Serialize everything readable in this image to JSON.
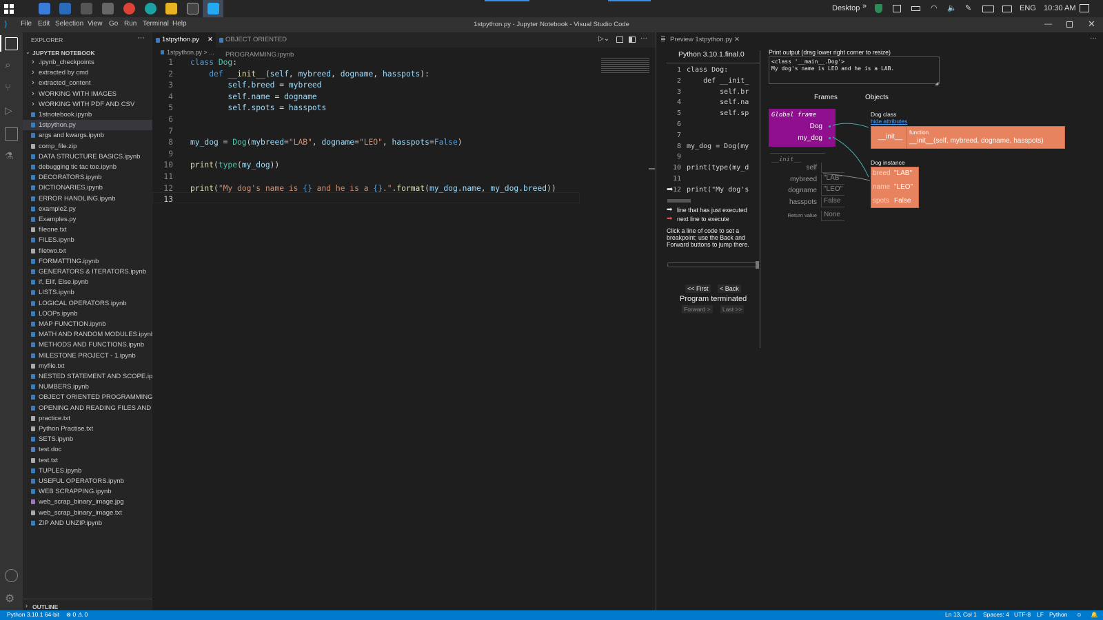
{
  "taskbar": {
    "desktop_label": "Desktop",
    "lang": "ENG",
    "time": "10:30 AM"
  },
  "window": {
    "title": "1stpython.py - Jupyter Notebook - Visual Studio Code",
    "menu": [
      "File",
      "Edit",
      "Selection",
      "View",
      "Go",
      "Run",
      "Terminal",
      "Help"
    ]
  },
  "explorer": {
    "header": "EXPLORER",
    "section": "JUPYTER NOTEBOOK",
    "outline": "OUTLINE",
    "items": [
      {
        "label": ".ipynb_checkpoints",
        "type": "folder"
      },
      {
        "label": "extracted by cmd",
        "type": "folder"
      },
      {
        "label": "extracted_content",
        "type": "folder"
      },
      {
        "label": "WORKING WITH IMAGES",
        "type": "folder"
      },
      {
        "label": "WORKING WITH PDF AND CSV",
        "type": "folder"
      },
      {
        "label": "1stnotebook.ipynb",
        "type": "notebook"
      },
      {
        "label": "1stpython.py",
        "type": "python"
      },
      {
        "label": "args and kwargs.ipynb",
        "type": "notebook"
      },
      {
        "label": "comp_file.zip",
        "type": "zip"
      },
      {
        "label": "DATA STRUCTURE BASICS.ipynb",
        "type": "notebook"
      },
      {
        "label": "debugging tic tac toe.ipynb",
        "type": "notebook"
      },
      {
        "label": "DECORATORS.ipynb",
        "type": "notebook"
      },
      {
        "label": "DICTIONARIES.ipynb",
        "type": "notebook"
      },
      {
        "label": "ERROR HANDLING.ipynb",
        "type": "notebook"
      },
      {
        "label": "example2.py",
        "type": "python"
      },
      {
        "label": "Examples.py",
        "type": "python"
      },
      {
        "label": "fileone.txt",
        "type": "text"
      },
      {
        "label": "FILES.ipynb",
        "type": "notebook"
      },
      {
        "label": "filetwo.txt",
        "type": "text"
      },
      {
        "label": "FORMATTING.ipynb",
        "type": "notebook"
      },
      {
        "label": "GENERATORS & ITERATORS.ipynb",
        "type": "notebook"
      },
      {
        "label": "if, Elif, Else.ipynb",
        "type": "notebook"
      },
      {
        "label": "LISTS.ipynb",
        "type": "notebook"
      },
      {
        "label": "LOGICAL OPERATORS.ipynb",
        "type": "notebook"
      },
      {
        "label": "LOOPs.ipynb",
        "type": "notebook"
      },
      {
        "label": "MAP FUNCTION.ipynb",
        "type": "notebook"
      },
      {
        "label": "MATH AND RANDOM MODULES.ipynb",
        "type": "notebook"
      },
      {
        "label": "METHODS AND FUNCTIONS.ipynb",
        "type": "notebook"
      },
      {
        "label": "MILESTONE PROJECT - 1.ipynb",
        "type": "notebook"
      },
      {
        "label": "myfile.txt",
        "type": "text"
      },
      {
        "label": "NESTED STATEMENT AND SCOPE.ipynb",
        "type": "notebook"
      },
      {
        "label": "NUMBERS.ipynb",
        "type": "notebook"
      },
      {
        "label": "OBJECT ORIENTED PROGRAMMING.ipy...",
        "type": "notebook"
      },
      {
        "label": "OPENING AND READING FILES AND FO...",
        "type": "notebook"
      },
      {
        "label": "practice.txt",
        "type": "text"
      },
      {
        "label": "Python Practise.txt",
        "type": "text"
      },
      {
        "label": "SETS.ipynb",
        "type": "notebook"
      },
      {
        "label": "test.doc",
        "type": "doc"
      },
      {
        "label": "test.txt",
        "type": "text"
      },
      {
        "label": "TUPLES.ipynb",
        "type": "notebook"
      },
      {
        "label": "USEFUL OPERATORS.ipynb",
        "type": "notebook"
      },
      {
        "label": "WEB SCRAPPING.ipynb",
        "type": "notebook"
      },
      {
        "label": "web_scrap_binary_image.jpg",
        "type": "image"
      },
      {
        "label": "web_scrap_binary_image.txt",
        "type": "text"
      },
      {
        "label": "ZIP AND UNZIP.ipynb",
        "type": "notebook"
      }
    ]
  },
  "editor": {
    "tabs": [
      "1stpython.py",
      "OBJECT ORIENTED PROGRAMMING.ipynb"
    ],
    "breadcrumb": "1stpython.py > ...",
    "line_numbers": [
      "1",
      "2",
      "3",
      "4",
      "5",
      "6",
      "7",
      "8",
      "9",
      "10",
      "11",
      "12",
      "13"
    ]
  },
  "preview": {
    "tab": "Preview 1stpython.py",
    "python_version": "Python 3.10.1.final.0",
    "print_output_label": "Print output (drag lower right corner to resize)",
    "print_output": [
      "<class '__main__.Dog'>",
      "My dog's name is LEO and he is a LAB."
    ],
    "code_lines": [
      {
        "n": "1",
        "t": "class Dog:"
      },
      {
        "n": "2",
        "t": "    def __init_"
      },
      {
        "n": "3",
        "t": "        self.br"
      },
      {
        "n": "4",
        "t": "        self.na"
      },
      {
        "n": "5",
        "t": "        self.sp"
      },
      {
        "n": "6",
        "t": ""
      },
      {
        "n": "7",
        "t": ""
      },
      {
        "n": "8",
        "t": "my_dog = Dog(my"
      },
      {
        "n": "9",
        "t": ""
      },
      {
        "n": "10",
        "t": "print(type(my_d"
      },
      {
        "n": "11",
        "t": ""
      },
      {
        "n": "12",
        "t": "print(\"My dog's"
      }
    ],
    "legend_executed": "line that has just executed",
    "legend_next": "next line to execute",
    "hint": "Click a line of code to set a breakpoint; use the Back and Forward buttons to jump there.",
    "btn_first": "<< First",
    "btn_back": "< Back",
    "status": "Program terminated",
    "btn_forward": "Forward >",
    "btn_last": "Last >>",
    "frames_label": "Frames",
    "objects_label": "Objects",
    "global_frame": "Global frame",
    "global_vars": [
      "Dog",
      "my_dog"
    ],
    "init_frame": "__init__",
    "init_vars": [
      {
        "name": "self",
        "value": ""
      },
      {
        "name": "mybreed",
        "value": "\"LAB\""
      },
      {
        "name": "dogname",
        "value": "\"LEO\""
      },
      {
        "name": "hasspots",
        "value": "False"
      },
      {
        "name": "Return value",
        "value": "None"
      }
    ],
    "dog_class_label": "Dog class",
    "hide_attributes": "hide attributes",
    "init_key": "__init__",
    "function_label": "function",
    "function_sig": "__init__(self, mybreed, dogname, hasspots)",
    "dog_instance_label": "Dog instance",
    "instance_attrs": [
      {
        "k": "breed",
        "v": "\"LAB\""
      },
      {
        "k": "name",
        "v": "\"LEO\""
      },
      {
        "k": "spots",
        "v": "False"
      }
    ]
  },
  "statusbar": {
    "interpreter": "Python 3.10.1 64-bit",
    "problems": "⊗ 0 ⚠ 0",
    "position": "Ln 13, Col 1",
    "spaces": "Spaces: 4",
    "encoding": "UTF-8",
    "eol": "LF",
    "language": "Python"
  },
  "colors": {
    "accent": "#007acc",
    "frame_purple": "#8f0f8f",
    "object_salmon": "#e8835f"
  }
}
